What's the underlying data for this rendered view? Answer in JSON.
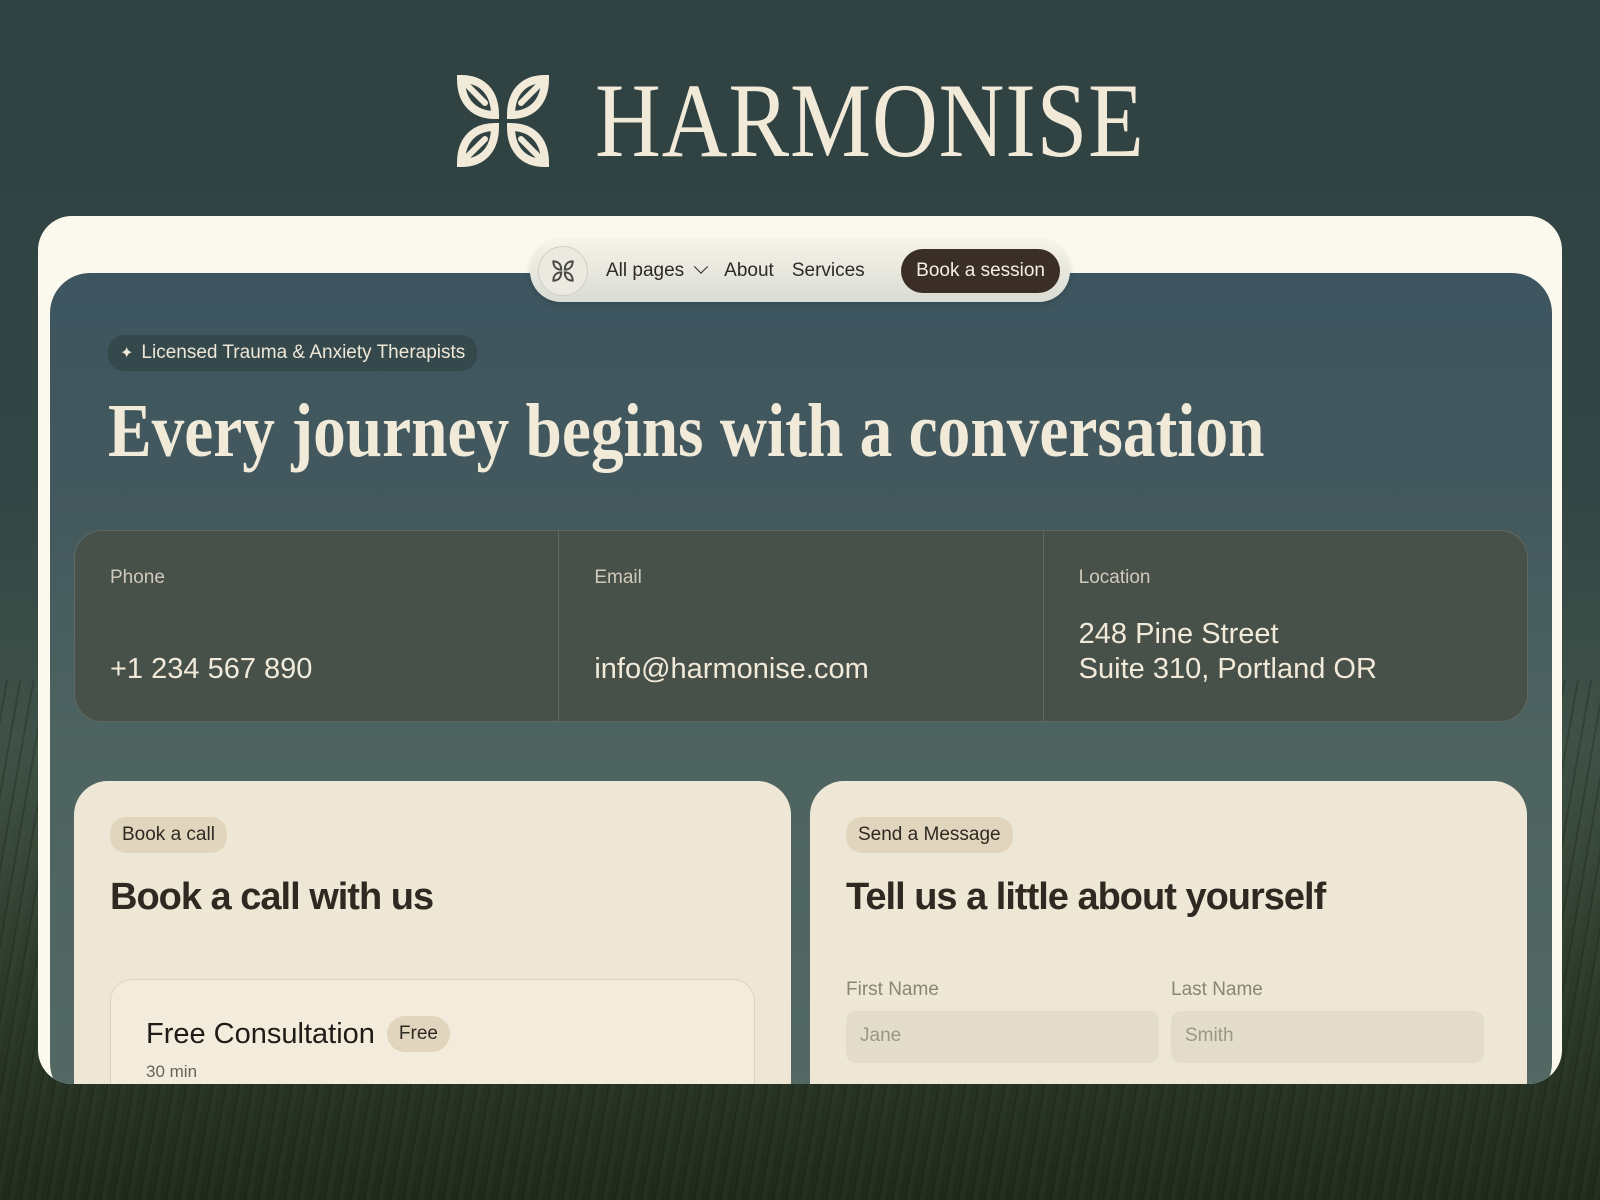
{
  "brand": {
    "name": "HARMONISE"
  },
  "nav": {
    "items": [
      {
        "label": "All pages",
        "has_dropdown": true
      },
      {
        "label": "About"
      },
      {
        "label": "Services"
      }
    ],
    "cta": "Book a session"
  },
  "hero": {
    "badge": "Licensed Trauma & Anxiety Therapists",
    "headline": "Every journey begins with a conversation"
  },
  "contact": {
    "phone": {
      "label": "Phone",
      "value": "+1 234 567 890"
    },
    "email": {
      "label": "Email",
      "value": "info@harmonise.com"
    },
    "location": {
      "label": "Location",
      "line1": "248 Pine Street",
      "line2": "Suite 310, Portland OR"
    }
  },
  "book_card": {
    "pill": "Book a call",
    "title": "Book a call with us",
    "consultation": {
      "title": "Free Consultation",
      "tag": "Free",
      "subtitle": "30 min"
    }
  },
  "message_card": {
    "pill": "Send a Message",
    "title": "Tell us a little about yourself",
    "first_name": {
      "label": "First Name",
      "placeholder": "Jane"
    },
    "last_name": {
      "label": "Last Name",
      "placeholder": "Smith"
    }
  },
  "colors": {
    "brand_cream": "#f1ead8",
    "cta_dark": "#3b2e26",
    "card_bg": "#efe7d6"
  }
}
